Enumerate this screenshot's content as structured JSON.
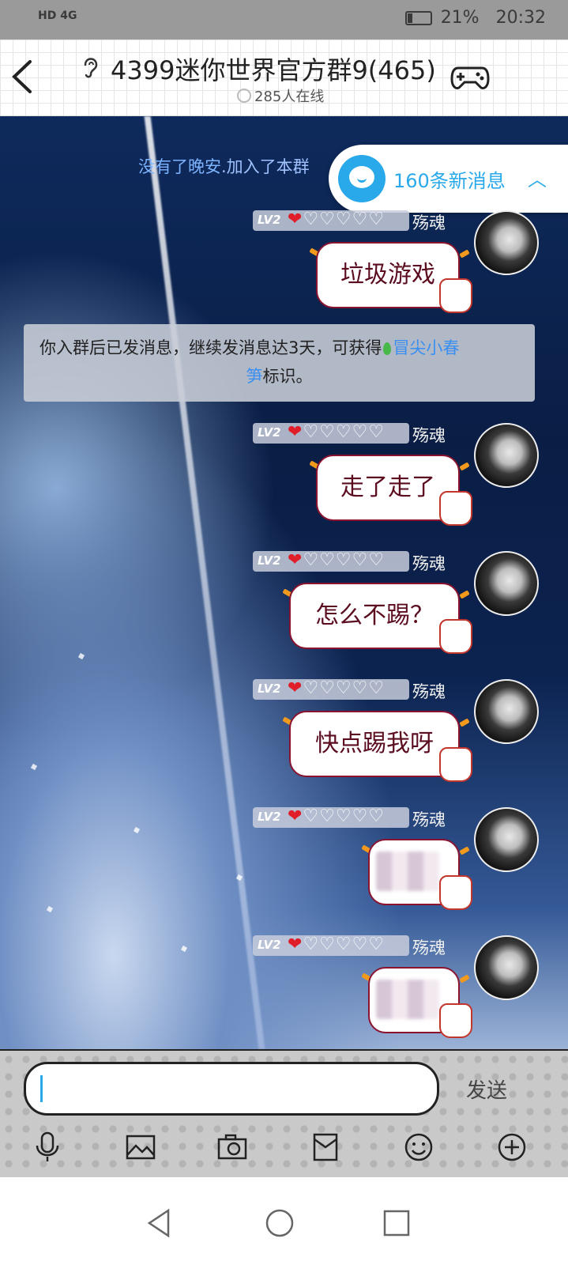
{
  "status_bar": {
    "network": "HD 4G",
    "battery": "21%",
    "time": "20:32"
  },
  "header": {
    "title": "4399迷你世界官方群9(465)",
    "online": "285人在线"
  },
  "chat": {
    "join_message_name": "没有了晚安",
    "join_message_suffix": ".加入了本群",
    "new_messages": "160条新消息",
    "notice": {
      "part1": "你入群后已发消息，继续发消息达3天，可获得",
      "highlight1": "冒尖小春",
      "highlight2": "笋",
      "part2": "标识。"
    },
    "messages": [
      {
        "level": "LV2",
        "hearts_full": "❤",
        "hearts_empty": "♡♡♡♡♡",
        "name": "殇魂",
        "text": "垃圾游戏"
      },
      {
        "level": "LV2",
        "hearts_full": "❤",
        "hearts_empty": "♡♡♡♡♡",
        "name": "殇魂",
        "text": "走了走了"
      },
      {
        "level": "LV2",
        "hearts_full": "❤",
        "hearts_empty": "♡♡♡♡♡",
        "name": "殇魂",
        "text": "怎么不踢？"
      },
      {
        "level": "LV2",
        "hearts_full": "❤",
        "hearts_empty": "♡♡♡♡♡",
        "name": "殇魂",
        "text": "快点踢我呀"
      },
      {
        "level": "LV2",
        "hearts_full": "❤",
        "hearts_empty": "♡♡♡♡♡",
        "name": "殇魂",
        "text": ""
      },
      {
        "level": "LV2",
        "hearts_full": "❤",
        "hearts_empty": "♡♡♡♡♡",
        "name": "殇魂",
        "text": ""
      }
    ]
  },
  "composer": {
    "send_label": "发送"
  },
  "colors": {
    "accent": "#29a9ea",
    "bubble_border": "#8a1330",
    "heart": "#e01e2a"
  },
  "icons": [
    "back-icon",
    "ear-icon",
    "gamepad-icon",
    "microphone-icon",
    "image-icon",
    "camera-icon",
    "red-packet-icon",
    "emoji-icon",
    "plus-icon",
    "nav-back-icon",
    "nav-home-icon",
    "nav-recents-icon"
  ]
}
